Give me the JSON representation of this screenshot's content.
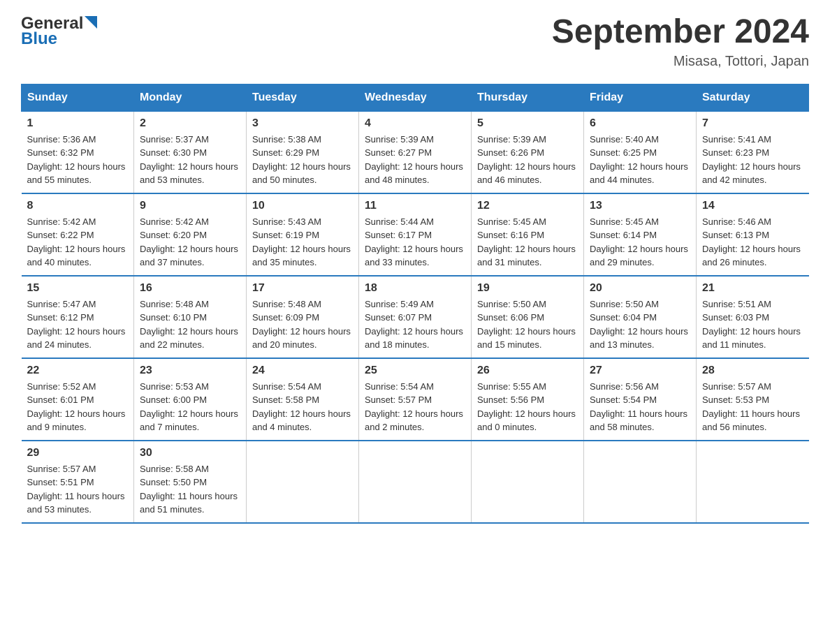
{
  "header": {
    "logo_general": "General",
    "logo_blue": "Blue",
    "month_title": "September 2024",
    "location": "Misasa, Tottori, Japan"
  },
  "weekdays": [
    "Sunday",
    "Monday",
    "Tuesday",
    "Wednesday",
    "Thursday",
    "Friday",
    "Saturday"
  ],
  "weeks": [
    [
      {
        "day": "1",
        "sunrise": "5:36 AM",
        "sunset": "6:32 PM",
        "daylight": "12 hours and 55 minutes."
      },
      {
        "day": "2",
        "sunrise": "5:37 AM",
        "sunset": "6:30 PM",
        "daylight": "12 hours and 53 minutes."
      },
      {
        "day": "3",
        "sunrise": "5:38 AM",
        "sunset": "6:29 PM",
        "daylight": "12 hours and 50 minutes."
      },
      {
        "day": "4",
        "sunrise": "5:39 AM",
        "sunset": "6:27 PM",
        "daylight": "12 hours and 48 minutes."
      },
      {
        "day": "5",
        "sunrise": "5:39 AM",
        "sunset": "6:26 PM",
        "daylight": "12 hours and 46 minutes."
      },
      {
        "day": "6",
        "sunrise": "5:40 AM",
        "sunset": "6:25 PM",
        "daylight": "12 hours and 44 minutes."
      },
      {
        "day": "7",
        "sunrise": "5:41 AM",
        "sunset": "6:23 PM",
        "daylight": "12 hours and 42 minutes."
      }
    ],
    [
      {
        "day": "8",
        "sunrise": "5:42 AM",
        "sunset": "6:22 PM",
        "daylight": "12 hours and 40 minutes."
      },
      {
        "day": "9",
        "sunrise": "5:42 AM",
        "sunset": "6:20 PM",
        "daylight": "12 hours and 37 minutes."
      },
      {
        "day": "10",
        "sunrise": "5:43 AM",
        "sunset": "6:19 PM",
        "daylight": "12 hours and 35 minutes."
      },
      {
        "day": "11",
        "sunrise": "5:44 AM",
        "sunset": "6:17 PM",
        "daylight": "12 hours and 33 minutes."
      },
      {
        "day": "12",
        "sunrise": "5:45 AM",
        "sunset": "6:16 PM",
        "daylight": "12 hours and 31 minutes."
      },
      {
        "day": "13",
        "sunrise": "5:45 AM",
        "sunset": "6:14 PM",
        "daylight": "12 hours and 29 minutes."
      },
      {
        "day": "14",
        "sunrise": "5:46 AM",
        "sunset": "6:13 PM",
        "daylight": "12 hours and 26 minutes."
      }
    ],
    [
      {
        "day": "15",
        "sunrise": "5:47 AM",
        "sunset": "6:12 PM",
        "daylight": "12 hours and 24 minutes."
      },
      {
        "day": "16",
        "sunrise": "5:48 AM",
        "sunset": "6:10 PM",
        "daylight": "12 hours and 22 minutes."
      },
      {
        "day": "17",
        "sunrise": "5:48 AM",
        "sunset": "6:09 PM",
        "daylight": "12 hours and 20 minutes."
      },
      {
        "day": "18",
        "sunrise": "5:49 AM",
        "sunset": "6:07 PM",
        "daylight": "12 hours and 18 minutes."
      },
      {
        "day": "19",
        "sunrise": "5:50 AM",
        "sunset": "6:06 PM",
        "daylight": "12 hours and 15 minutes."
      },
      {
        "day": "20",
        "sunrise": "5:50 AM",
        "sunset": "6:04 PM",
        "daylight": "12 hours and 13 minutes."
      },
      {
        "day": "21",
        "sunrise": "5:51 AM",
        "sunset": "6:03 PM",
        "daylight": "12 hours and 11 minutes."
      }
    ],
    [
      {
        "day": "22",
        "sunrise": "5:52 AM",
        "sunset": "6:01 PM",
        "daylight": "12 hours and 9 minutes."
      },
      {
        "day": "23",
        "sunrise": "5:53 AM",
        "sunset": "6:00 PM",
        "daylight": "12 hours and 7 minutes."
      },
      {
        "day": "24",
        "sunrise": "5:54 AM",
        "sunset": "5:58 PM",
        "daylight": "12 hours and 4 minutes."
      },
      {
        "day": "25",
        "sunrise": "5:54 AM",
        "sunset": "5:57 PM",
        "daylight": "12 hours and 2 minutes."
      },
      {
        "day": "26",
        "sunrise": "5:55 AM",
        "sunset": "5:56 PM",
        "daylight": "12 hours and 0 minutes."
      },
      {
        "day": "27",
        "sunrise": "5:56 AM",
        "sunset": "5:54 PM",
        "daylight": "11 hours and 58 minutes."
      },
      {
        "day": "28",
        "sunrise": "5:57 AM",
        "sunset": "5:53 PM",
        "daylight": "11 hours and 56 minutes."
      }
    ],
    [
      {
        "day": "29",
        "sunrise": "5:57 AM",
        "sunset": "5:51 PM",
        "daylight": "11 hours and 53 minutes."
      },
      {
        "day": "30",
        "sunrise": "5:58 AM",
        "sunset": "5:50 PM",
        "daylight": "11 hours and 51 minutes."
      },
      null,
      null,
      null,
      null,
      null
    ]
  ],
  "labels": {
    "sunrise": "Sunrise:",
    "sunset": "Sunset:",
    "daylight": "Daylight:"
  }
}
